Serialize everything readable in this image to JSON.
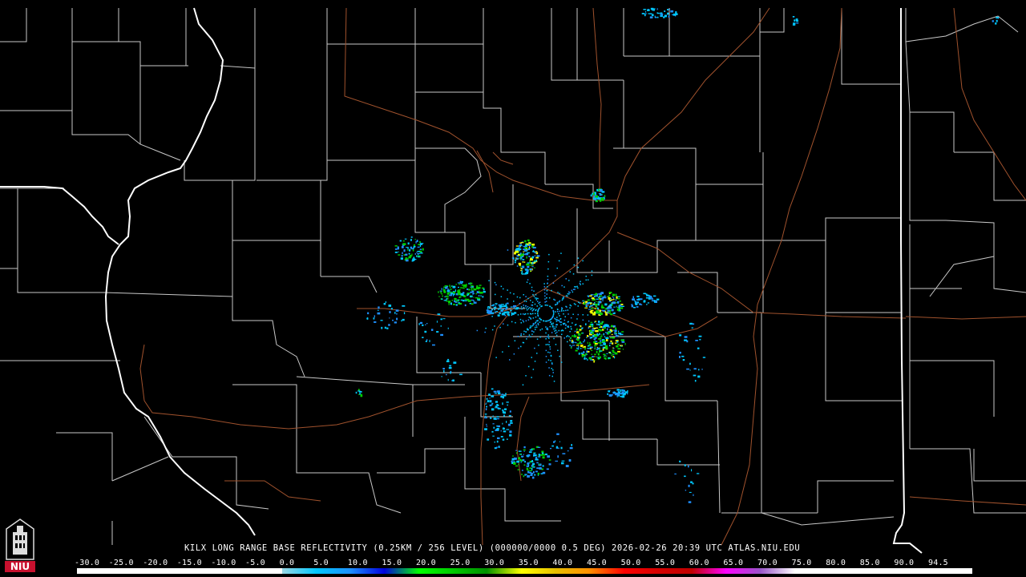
{
  "caption": {
    "station": "KILX",
    "product": "LONG RANGE BASE REFLECTIVITY (0.25KM / 256 LEVEL)",
    "volume": "(000000/0000 0.5 DEG)",
    "datetime": "2026-02-26 20:39 UTC",
    "site": "ATLAS.NIU.EDU"
  },
  "logo": {
    "text": "NIU",
    "color": "#c8102e"
  },
  "colorscale": {
    "labels": [
      "-30.0",
      "-25.0",
      "-20.0",
      "-15.0",
      "-10.0",
      "-5.0",
      "0.0",
      "5.0",
      "10.0",
      "15.0",
      "20.0",
      "25.0",
      "30.0",
      "35.0",
      "40.0",
      "45.0",
      "50.0",
      "55.0",
      "60.0",
      "65.0",
      "70.0",
      "75.0",
      "80.0",
      "85.0",
      "90.0",
      "94.5"
    ],
    "colors": [
      "#ffffff",
      "#ffffff",
      "#ffffff",
      "#ffffff",
      "#ffffff",
      "#ffffff",
      "#9ad7e4",
      "#00c8ff",
      "#1e90ff",
      "#0000dd",
      "#00ff00",
      "#00c800",
      "#009000",
      "#ffff00",
      "#e7c000",
      "#ff9000",
      "#ff0000",
      "#d60000",
      "#c00000",
      "#ff00ff",
      "#9955c9",
      "#ffffff",
      "#ffffff",
      "#ffffff",
      "#ffffff"
    ]
  },
  "map": {
    "county_color": "#c8c8c8",
    "state_color": "#ffffff",
    "highway_color": "#a0522d",
    "echo_colors": {
      "light": "#00c8ff",
      "blue": "#1e90ff",
      "green": "#00d000",
      "yellow": "#ffff00",
      "deep": "#0000dd"
    }
  }
}
